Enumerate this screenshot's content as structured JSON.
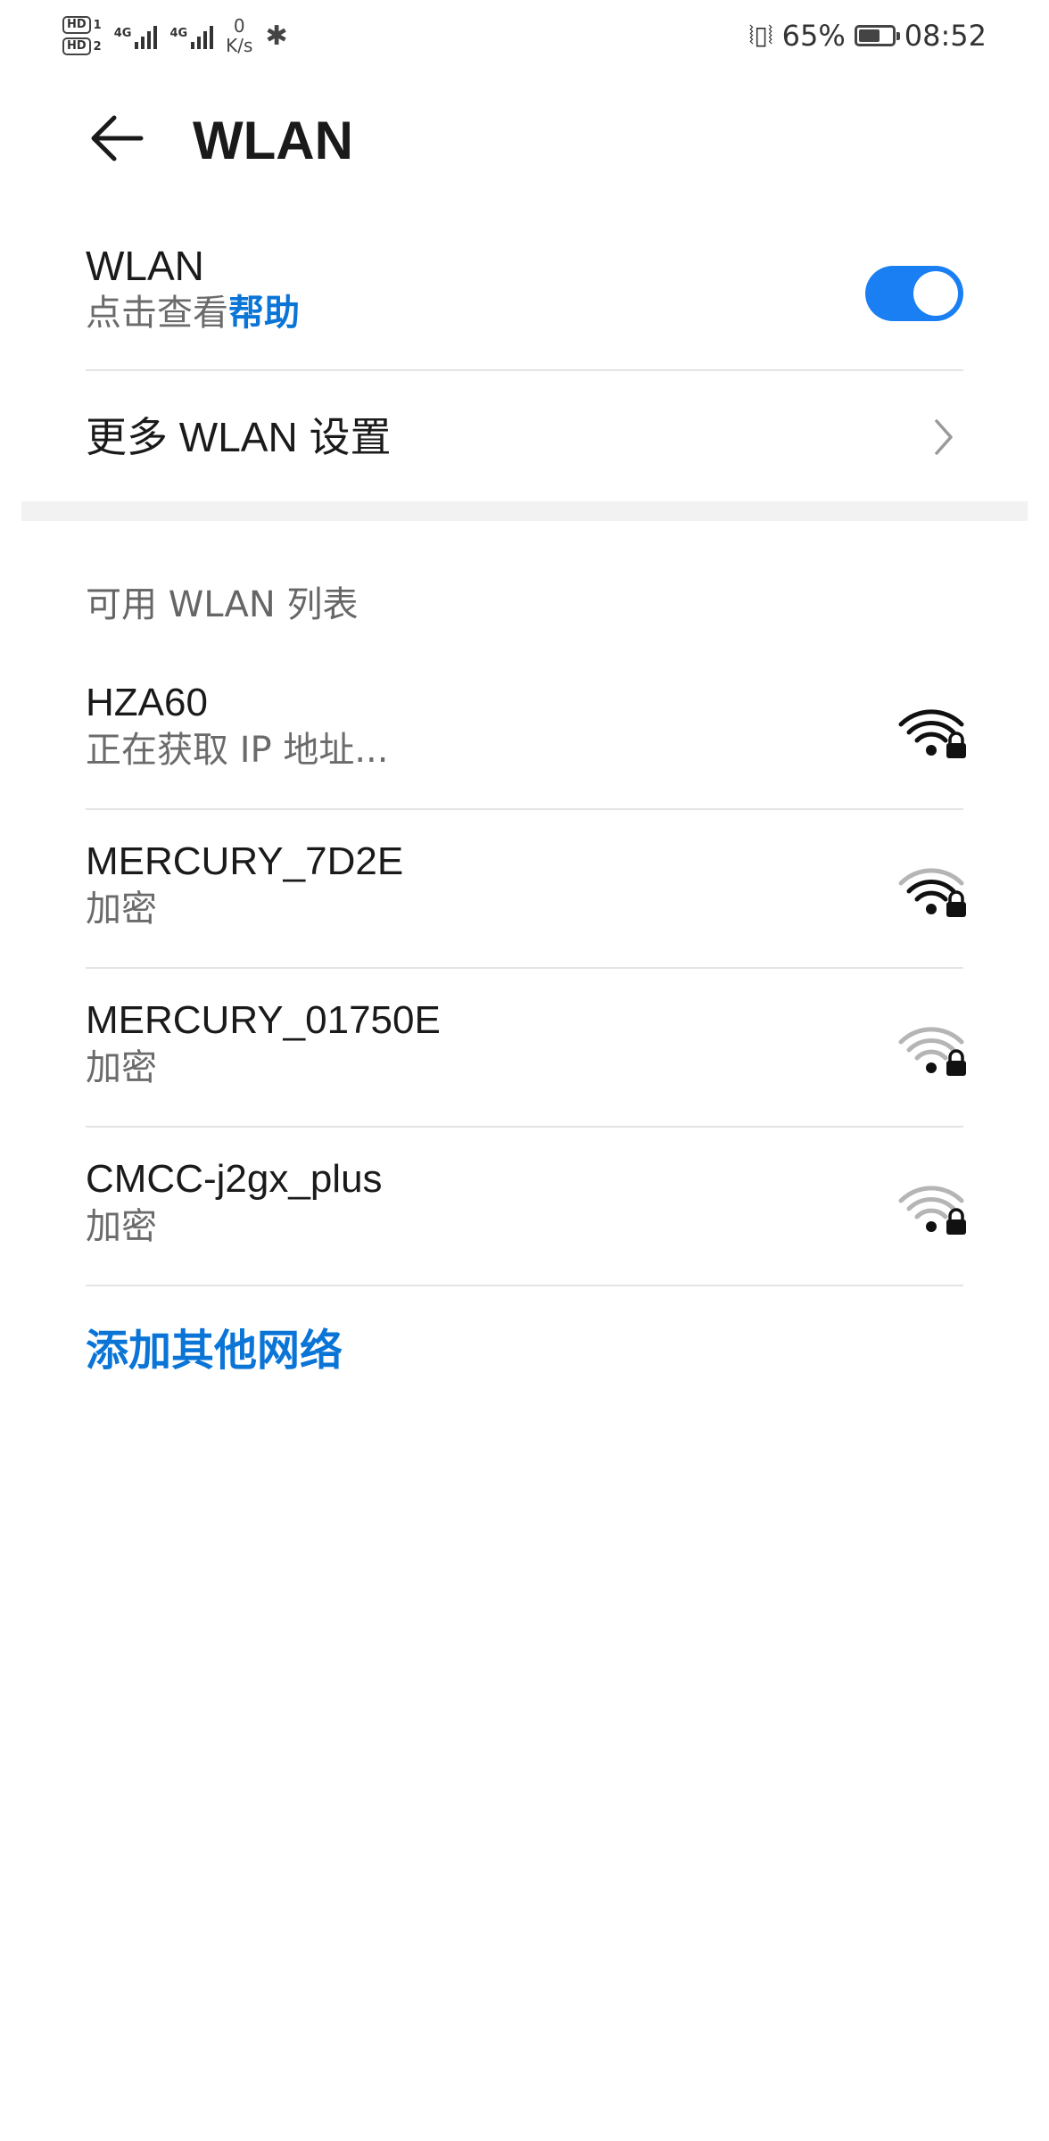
{
  "status_bar": {
    "hd1": "HD",
    "hd1_num": "1",
    "hd2": "HD",
    "hd2_num": "2",
    "signal1_label": "4G",
    "signal2_label": "4G",
    "speed_value": "0",
    "speed_unit": "K/s",
    "battery_percent_text": "65%",
    "battery_level": 0.65,
    "time": "08:52"
  },
  "header": {
    "title": "WLAN"
  },
  "wlan": {
    "label": "WLAN",
    "hint_prefix": "点击查看",
    "hint_link": "帮助",
    "enabled": true
  },
  "more_settings": {
    "label": "更多 WLAN 设置"
  },
  "available": {
    "title": "可用 WLAN 列表",
    "networks": [
      {
        "name": "HZA60",
        "status": "正在获取 IP 地址...",
        "signal": 4,
        "secured": true
      },
      {
        "name": "MERCURY_7D2E",
        "status": "加密",
        "signal": 3,
        "secured": true
      },
      {
        "name": "MERCURY_01750E",
        "status": "加密",
        "signal": 1,
        "secured": true
      },
      {
        "name": "CMCC-j2gx_plus",
        "status": "加密",
        "signal": 1,
        "secured": true
      }
    ]
  },
  "add_network": {
    "label": "添加其他网络"
  },
  "colors": {
    "accent": "#0a75d6",
    "toggle_on": "#1a7ff2",
    "text_primary": "#1a1a1a",
    "text_secondary": "#6b6b6b",
    "signal_strong": "#111111",
    "signal_weak": "#b5b5b5"
  },
  "icons": {
    "back": "arrow-left-icon",
    "chevron": "chevron-right-icon",
    "wifi": "wifi-lock-icon",
    "bluetooth": "bluetooth-icon",
    "vibrate": "vibrate-icon",
    "battery": "battery-icon"
  }
}
